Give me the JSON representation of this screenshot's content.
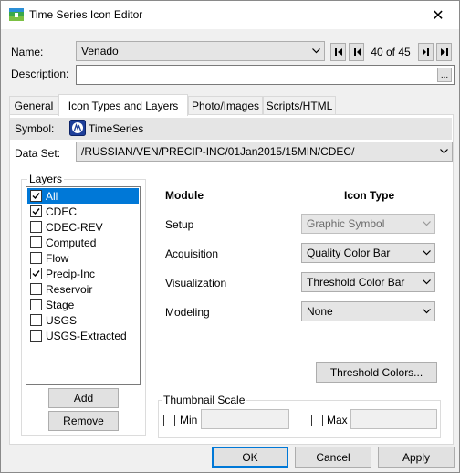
{
  "window": {
    "title": "Time Series Icon Editor",
    "close_glyph": "✕"
  },
  "header": {
    "name_label": "Name:",
    "name_value": "Venado",
    "description_label": "Description:",
    "description_button": "...",
    "counter": "40 of 45"
  },
  "tabs": [
    {
      "label": "General"
    },
    {
      "label": "Icon Types and Layers"
    },
    {
      "label": "Photo/Images"
    },
    {
      "label": "Scripts/HTML"
    }
  ],
  "symbol": {
    "label": "Symbol:",
    "value": "TimeSeries",
    "icon": "timeseries-symbol-icon"
  },
  "dataset": {
    "label": "Data Set:",
    "value": "/RUSSIAN/VEN/PRECIP-INC/01Jan2015/15MIN/CDEC/"
  },
  "layers": {
    "title": "Layers",
    "items": [
      {
        "label": "All",
        "checked": true,
        "selected": true
      },
      {
        "label": "CDEC",
        "checked": true,
        "selected": false
      },
      {
        "label": "CDEC-REV",
        "checked": false,
        "selected": false
      },
      {
        "label": "Computed",
        "checked": false,
        "selected": false
      },
      {
        "label": "Flow",
        "checked": false,
        "selected": false
      },
      {
        "label": "Precip-Inc",
        "checked": true,
        "selected": false
      },
      {
        "label": "Reservoir",
        "checked": false,
        "selected": false
      },
      {
        "label": "Stage",
        "checked": false,
        "selected": false
      },
      {
        "label": "USGS",
        "checked": false,
        "selected": false
      },
      {
        "label": "USGS-Extracted",
        "checked": false,
        "selected": false
      }
    ],
    "add_label": "Add",
    "remove_label": "Remove"
  },
  "modules": {
    "module_header": "Module",
    "icontype_header": "Icon Type",
    "rows": [
      {
        "module": "Setup",
        "icon_type": "Graphic Symbol",
        "disabled": true
      },
      {
        "module": "Acquisition",
        "icon_type": "Quality Color Bar",
        "disabled": false
      },
      {
        "module": "Visualization",
        "icon_type": "Threshold Color Bar",
        "disabled": false
      },
      {
        "module": "Modeling",
        "icon_type": "None",
        "disabled": false
      }
    ],
    "threshold_button": "Threshold Colors..."
  },
  "thumbnail": {
    "title": "Thumbnail Scale",
    "min_label": "Min",
    "max_label": "Max",
    "min_value": "",
    "max_value": ""
  },
  "footer": {
    "ok": "OK",
    "cancel": "Cancel",
    "apply": "Apply"
  },
  "colors": {
    "accent": "#0078d7",
    "selection": "#0078d7",
    "panel": "#f0f0f0"
  }
}
